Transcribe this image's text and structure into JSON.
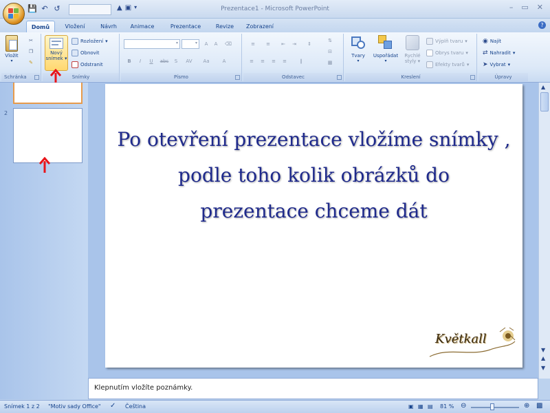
{
  "window": {
    "title": "Prezentace1 - Microsoft PowerPoint",
    "controls": [
      "–",
      "▭",
      "✕"
    ]
  },
  "tabs": [
    {
      "label": "Domů",
      "active": true
    },
    {
      "label": "Vložení",
      "active": false
    },
    {
      "label": "Návrh",
      "active": false
    },
    {
      "label": "Animace",
      "active": false
    },
    {
      "label": "Prezentace",
      "active": false
    },
    {
      "label": "Revize",
      "active": false
    },
    {
      "label": "Zobrazení",
      "active": false
    }
  ],
  "ribbon": {
    "clipboard": {
      "label": "Schránka",
      "paste": "Vložit"
    },
    "slides": {
      "label": "Snímky",
      "new_slide_line1": "Nový",
      "new_slide_line2": "snímek",
      "layout": "Rozložení",
      "reset": "Obnovit",
      "delete": "Odstranit"
    },
    "font": {
      "label": "Písmo"
    },
    "paragraph": {
      "label": "Odstavec"
    },
    "drawing": {
      "label": "Kreslení",
      "shapes": "Tvary",
      "arrange": "Uspořádat",
      "quick_styles_line1": "Rychlé",
      "quick_styles_line2": "styly",
      "shape_fill": "Výplň tvaru",
      "shape_outline": "Obrys tvaru",
      "shape_effects": "Efekty tvarů"
    },
    "editing": {
      "label": "Úpravy",
      "find": "Najít",
      "replace": "Nahradit",
      "select": "Vybrat"
    }
  },
  "slides_panel": {
    "slide2_number": "2"
  },
  "slide": {
    "line1": "Po otevření prezentace vložíme snímky ,",
    "line2": "podle toho kolik obrázků do",
    "line3": "prezentace chceme dát",
    "signature": "Květkall"
  },
  "notes": {
    "placeholder": "Klepnutím vložíte poznámky."
  },
  "status": {
    "slide_counter": "Snímek 1 z 2",
    "theme": "\"Motiv sady Office\"",
    "language": "Čeština",
    "zoom": "81 %",
    "zoom_fraction": 0.44
  },
  "colors": {
    "annotation_arrow": "#e8141a",
    "slide_text": "#1f2a8c",
    "selected_thumb_border": "#e79a4a"
  }
}
